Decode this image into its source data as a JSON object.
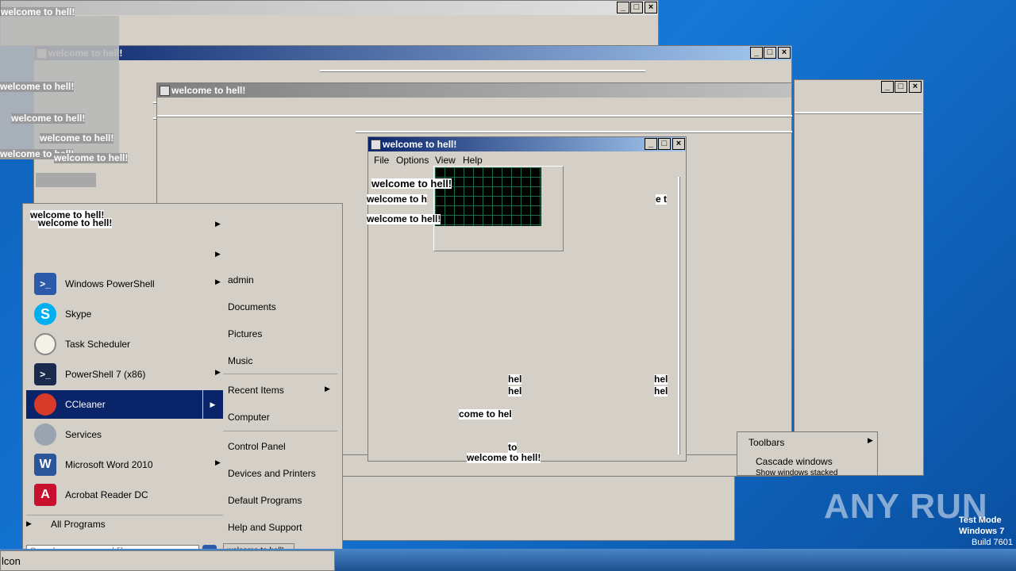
{
  "windows": {
    "title": "welcome to hell!",
    "menu": [
      "File",
      "Options",
      "View",
      "Help"
    ]
  },
  "glitch_text": [
    "welcome to hell!",
    "welcome to hell!",
    "welcome to h",
    "e t",
    "come to hell",
    "welcome to hell!",
    "hel",
    "hel",
    "hel",
    "hel",
    "to",
    "come to hel",
    "lcome to hell"
  ],
  "start_menu": {
    "header": [
      "welcome to hell!",
      "welcome to hell!"
    ],
    "programs": [
      {
        "label": "Windows PowerShell",
        "icon": "powershell-icon",
        "submenu": true
      },
      {
        "label": "Skype",
        "icon": "skype-icon",
        "submenu": false
      },
      {
        "label": "Task Scheduler",
        "icon": "clock-icon",
        "submenu": false
      },
      {
        "label": "PowerShell 7 (x86)",
        "icon": "powershell7-icon",
        "submenu": true
      },
      {
        "label": "CCleaner",
        "icon": "ccleaner-icon",
        "submenu": true
      },
      {
        "label": "Services",
        "icon": "gears-icon",
        "submenu": false
      },
      {
        "label": "Microsoft Word 2010",
        "icon": "word-icon",
        "submenu": true
      },
      {
        "label": "Acrobat Reader DC",
        "icon": "acrobat-icon",
        "submenu": false
      }
    ],
    "all_programs": "All Programs",
    "search_placeholder": "Search programs and files",
    "right": [
      "admin",
      "Documents",
      "Pictures",
      "Music",
      "Recent Items",
      "Computer",
      "Control Panel",
      "Devices and Printers",
      "Default Programs",
      "Help and Support"
    ],
    "shutdown_label": "welcome to hell!"
  },
  "context_menu": {
    "toolbars": "Toolbars",
    "cascade": "Cascade windows",
    "stacked": "Show windows stacked"
  },
  "watermark": {
    "brand": "ANY RUN",
    "line1": "Test Mode",
    "line2": "Windows 7",
    "line3": "Build 7601"
  },
  "taskbar": {
    "text": "lcon"
  },
  "colors": {
    "titlebar_active": "#0a246a",
    "face": "#d4d0c8",
    "selection": "#0a246a"
  }
}
